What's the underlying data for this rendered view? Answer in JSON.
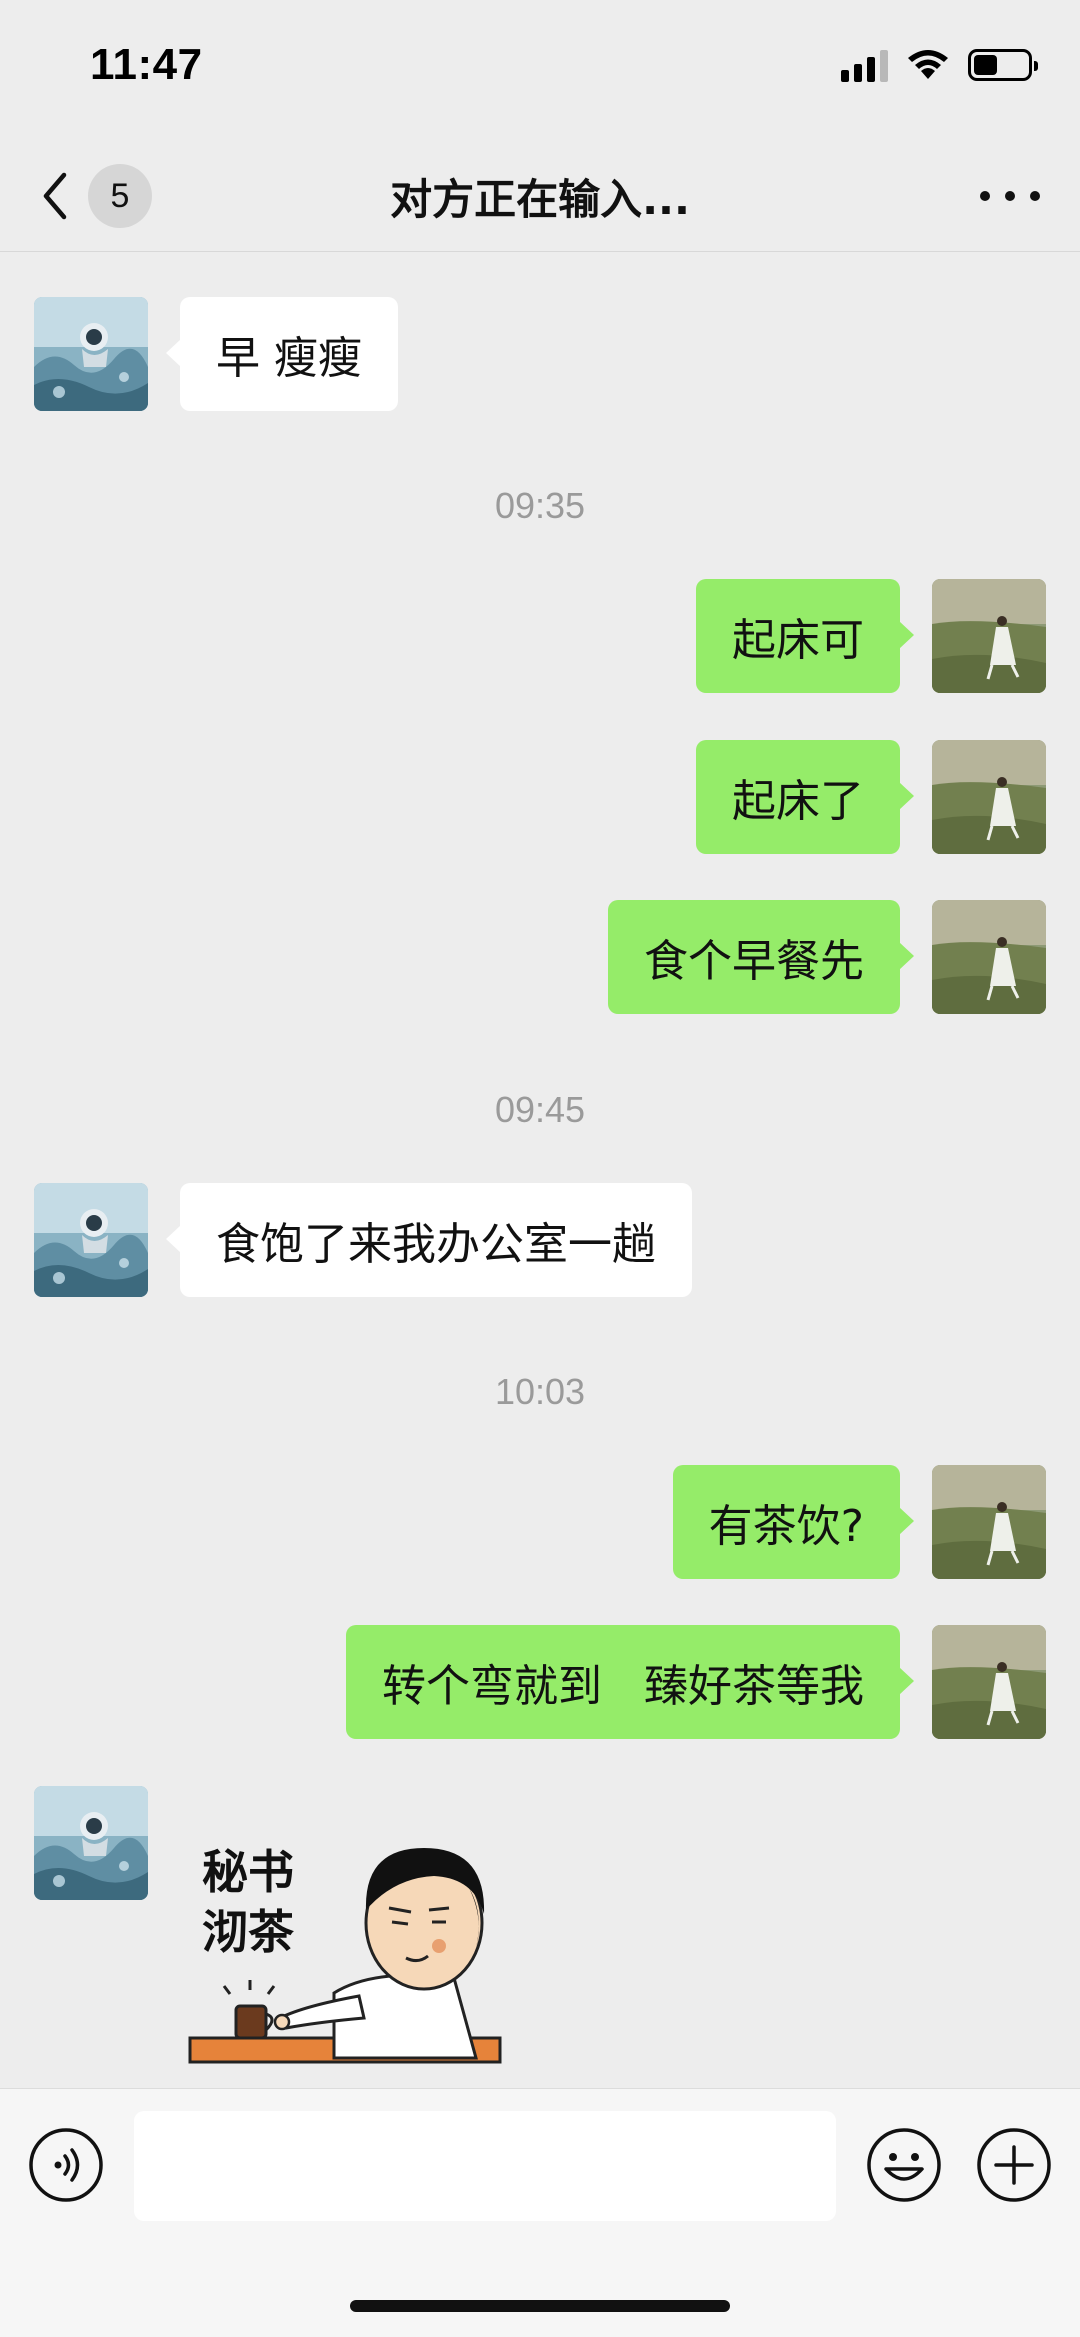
{
  "status_bar": {
    "time": "11:47",
    "signal_icon": "cellular-signal-icon",
    "wifi_icon": "wifi-icon",
    "battery_icon": "battery-icon"
  },
  "nav": {
    "back_icon": "chevron-left-icon",
    "unread_count": "5",
    "title": "对方正在输入...",
    "more_icon": "ellipsis-icon"
  },
  "messages": [
    {
      "side": "in",
      "text": "早 瘦瘦"
    },
    {
      "type": "time",
      "text": "09:35"
    },
    {
      "side": "out",
      "text": "起床可"
    },
    {
      "side": "out",
      "text": "起床了"
    },
    {
      "side": "out",
      "text": "食个早餐先"
    },
    {
      "type": "time",
      "text": "09:45"
    },
    {
      "side": "in",
      "text": "食饱了来我办公室一趟"
    },
    {
      "type": "time",
      "text": "10:03"
    },
    {
      "side": "out",
      "text": "有茶饮?"
    },
    {
      "side": "out",
      "text": "转个弯就到   臻好茶等我"
    },
    {
      "side": "in",
      "type": "sticker",
      "text": "秘书沏茶"
    }
  ],
  "input_bar": {
    "voice_icon": "voice-input-icon",
    "input_value": "",
    "emoji_icon": "emoji-icon",
    "plus_icon": "plus-icon"
  },
  "colors": {
    "background": "#ededed",
    "outgoing_bubble": "#95ec69",
    "incoming_bubble": "#ffffff",
    "timestamp": "#9a9a9a"
  }
}
